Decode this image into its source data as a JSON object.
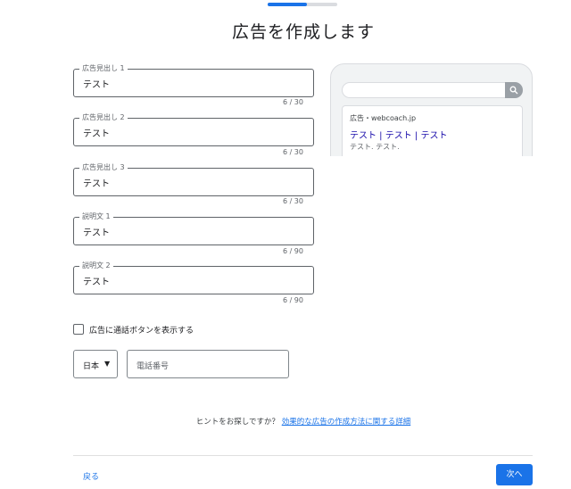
{
  "page": {
    "title": "広告を作成します",
    "progress": 0.56
  },
  "fields": [
    {
      "label": "広告見出し 1",
      "value": "テスト",
      "counter": "6 / 30"
    },
    {
      "label": "広告見出し 2",
      "value": "テスト",
      "counter": "6 / 30"
    },
    {
      "label": "広告見出し 3",
      "value": "テスト",
      "counter": "6 / 30"
    },
    {
      "label": "説明文 1",
      "value": "テスト",
      "counter": "6 / 90"
    },
    {
      "label": "説明文 2",
      "value": "テスト",
      "counter": "6 / 90"
    }
  ],
  "preview": {
    "ad_meta": "広告・webcoach.jp",
    "headline": "テスト | テスト | テスト",
    "description": "テスト. テスト."
  },
  "call_button": {
    "label": "広告に通話ボタンを表示する",
    "checked": false
  },
  "country": {
    "selected": "日本"
  },
  "phone": {
    "placeholder": "電話番号"
  },
  "hint": {
    "text": "ヒントをお探しですか？",
    "link": "効果的な広告の作成方法に関する詳細"
  },
  "nav": {
    "back": "戻る",
    "next": "次へ"
  },
  "colors": {
    "accent": "#1a73e8",
    "headline_link": "#1a0dab"
  },
  "icons": {
    "search": "search-icon",
    "caret": "caret-down-icon"
  }
}
